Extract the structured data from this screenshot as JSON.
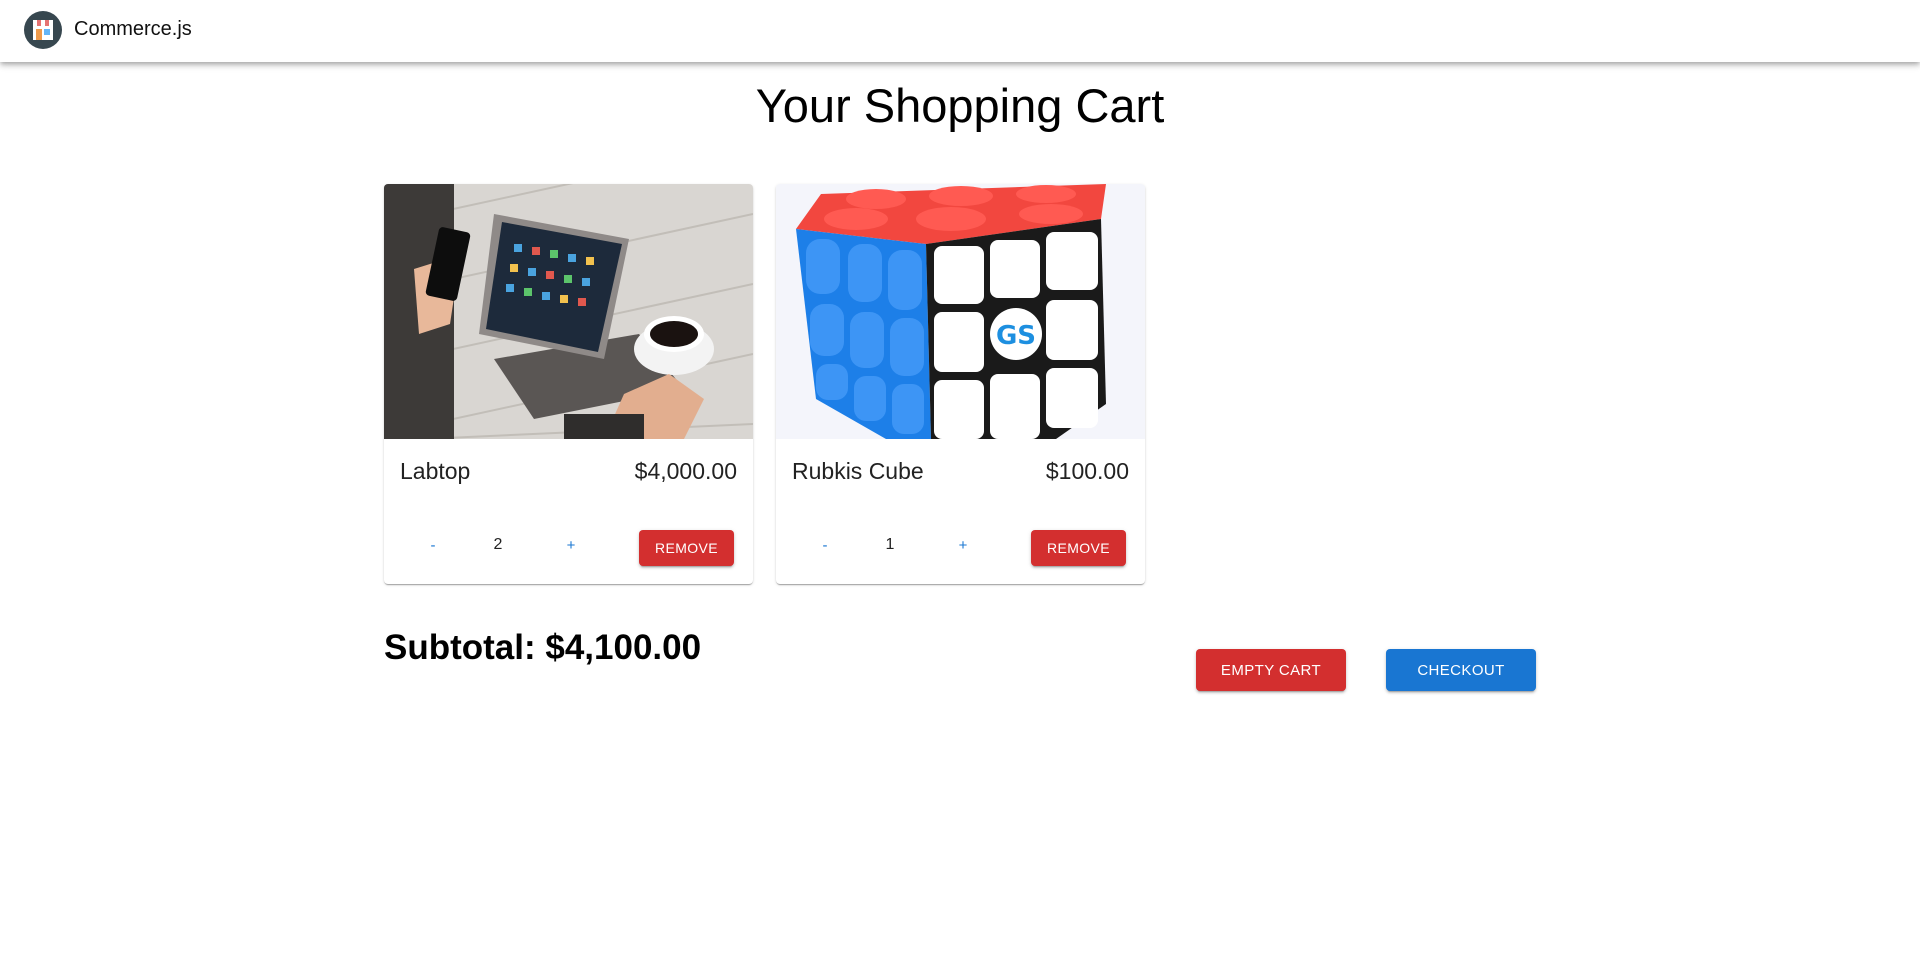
{
  "app": {
    "brand": "Commerce.js",
    "logo_icon": "store-icon"
  },
  "page": {
    "title": "Your Shopping Cart"
  },
  "cart": {
    "items": [
      {
        "name": "Labtop",
        "price": "$4,000.00",
        "quantity": "2",
        "decrement_label": "-",
        "increment_label": "+",
        "remove_label": "REMOVE",
        "image_icon": "laptop-photo"
      },
      {
        "name": "Rubkis Cube",
        "price": "$100.00",
        "quantity": "1",
        "decrement_label": "-",
        "increment_label": "+",
        "remove_label": "REMOVE",
        "image_icon": "rubiks-cube-photo"
      }
    ],
    "subtotal": "Subtotal: $4,100.00",
    "empty_cart_label": "EMPTY CART",
    "checkout_label": "CHECKOUT"
  },
  "colors": {
    "primary": "#1976d2",
    "danger": "#d32f2f"
  }
}
